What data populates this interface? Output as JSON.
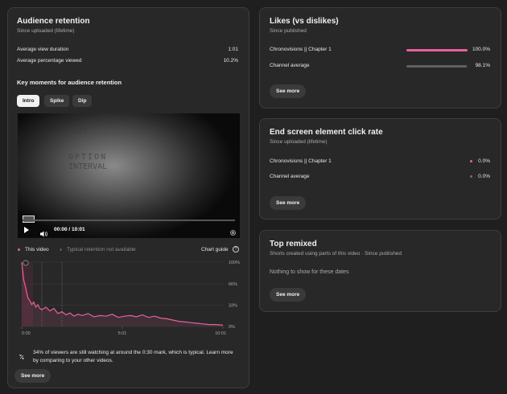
{
  "retention": {
    "title": "Audience retention",
    "subtitle": "Since uploaded (lifetime)",
    "avg_view_label": "Average view duration",
    "avg_view_value": "1:01",
    "avg_pct_label": "Average percentage viewed",
    "avg_pct_value": "10.2%",
    "key_moments_title": "Key moments for audience retention",
    "chips": [
      "Intro",
      "Spike",
      "Dip"
    ],
    "video_overlay_lines": [
      "PLAY",
      "OPTION",
      "INTERVAL"
    ],
    "video_time": "00:00 / 10:01",
    "legend_this": "This video",
    "legend_typical": "Typical retention not available",
    "chart_guide": "Chart guide",
    "insight": "34% of viewers are still watching at around the 0:30 mark, which is typical. Learn more by comparing to your other videos.",
    "see_more": "See more"
  },
  "likes": {
    "title": "Likes (vs dislikes)",
    "subtitle": "Since published",
    "rows": [
      {
        "label": "Chronovisions || Chapter 1",
        "value": "100.0%",
        "fraction": 1.0,
        "color": "#e8609c"
      },
      {
        "label": "Channel average",
        "value": "98.1%",
        "fraction": 0.981,
        "color": "#606060"
      }
    ],
    "see_more": "See more"
  },
  "endscreen": {
    "title": "End screen element click rate",
    "subtitle": "Since uploaded (lifetime)",
    "rows": [
      {
        "label": "Chronovisions || Chapter 1",
        "value": "0.0%",
        "color": "#e8609c"
      },
      {
        "label": "Channel average",
        "value": "0.0%",
        "color": "#707070"
      }
    ],
    "see_more": "See more"
  },
  "remixed": {
    "title": "Top remixed",
    "subtitle": "Shorts created using parts of this video · Since published",
    "empty": "Nothing to show for these dates",
    "see_more": "See more"
  },
  "chart_data": {
    "type": "area",
    "x_ticks": [
      "0:00",
      "5:01",
      "10:01"
    ],
    "y_ticks": [
      "100%",
      "66%",
      "33%",
      "0%"
    ],
    "ylim": [
      0,
      100
    ],
    "series": [
      {
        "name": "This video",
        "color": "#e8609c",
        "x_frac": [
          0,
          0.01,
          0.02,
          0.03,
          0.04,
          0.05,
          0.06,
          0.07,
          0.08,
          0.09,
          0.1,
          0.12,
          0.14,
          0.16,
          0.18,
          0.2,
          0.22,
          0.24,
          0.26,
          0.28,
          0.3,
          0.33,
          0.36,
          0.39,
          0.42,
          0.45,
          0.48,
          0.51,
          0.54,
          0.57,
          0.6,
          0.63,
          0.66,
          0.69,
          0.72,
          0.75,
          0.78,
          0.81,
          0.84,
          0.87,
          0.9,
          0.93,
          0.96,
          1.0
        ],
        "values": [
          100,
          72,
          60,
          45,
          40,
          34,
          38,
          30,
          34,
          28,
          26,
          30,
          24,
          28,
          20,
          23,
          18,
          21,
          16,
          19,
          17,
          20,
          15,
          17,
          16,
          19,
          14,
          16,
          17,
          15,
          18,
          14,
          16,
          13,
          12,
          10,
          8,
          7,
          6,
          5,
          4,
          3,
          3,
          2
        ]
      }
    ]
  }
}
